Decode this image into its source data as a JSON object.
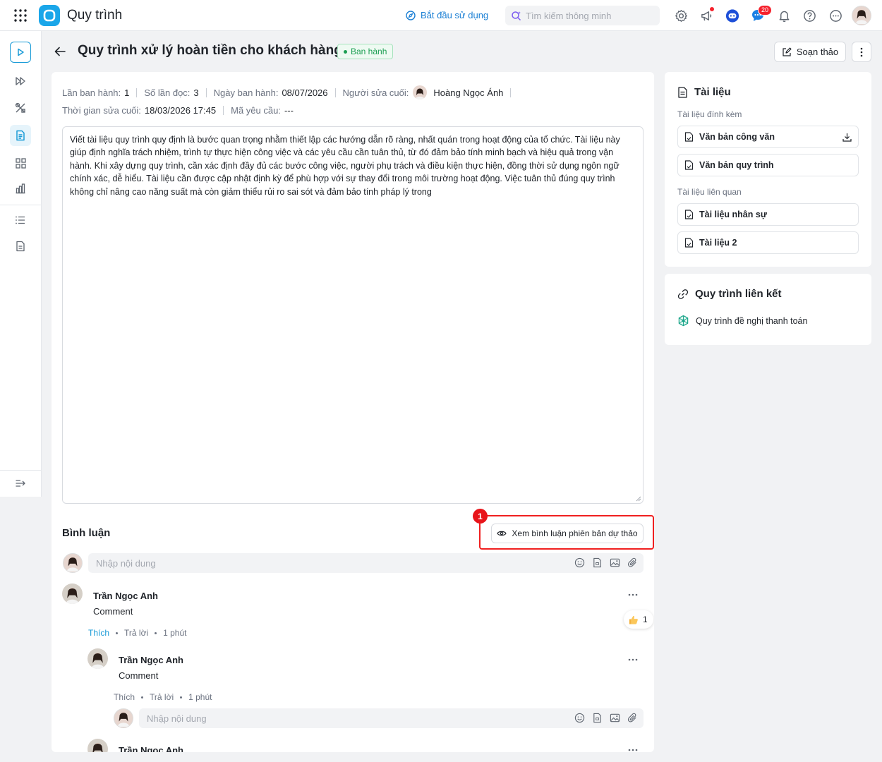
{
  "app": {
    "title": "Quy trình"
  },
  "topbar": {
    "start_label": "Bắt đầu sử dụng",
    "search_placeholder": "Tìm kiếm thông minh",
    "chat_badge": "20"
  },
  "page": {
    "title": "Quy trình xử lý hoàn tiền cho khách hàng",
    "status": "Ban hành",
    "draft_button": "Soạn thảo"
  },
  "meta": {
    "release_count_label": "Lần ban hành:",
    "release_count": "1",
    "read_count_label": "Số lần đọc:",
    "read_count": "3",
    "release_date_label": "Ngày ban hành:",
    "release_date": "08/07/2026",
    "last_editor_label": "Người sửa cuối:",
    "last_editor": "Hoàng Ngọc Ánh",
    "last_edit_time_label": "Thời gian sửa cuối:",
    "last_edit_time": "18/03/2026 17:45",
    "request_code_label": "Mã yêu cầu:",
    "request_code": "---"
  },
  "document": {
    "body": "Viết tài liệu quy trình quy định là bước quan trọng nhằm thiết lập các hướng dẫn rõ ràng, nhất quán trong hoạt động của tổ chức. Tài liệu này giúp định nghĩa trách nhiệm, trình tự thực hiện công việc và các yêu cầu cần tuân thủ, từ đó đảm bảo tính minh bạch và hiệu quả trong vận hành. Khi xây dựng quy trình, cần xác định đầy đủ các bước công việc, người phụ trách và điều kiện thực hiện, đồng thời sử dụng ngôn ngữ chính xác, dễ hiểu. Tài liệu cần được cập nhật định kỳ để phù hợp với sự thay đổi trong môi trường hoạt động. Việc tuân thủ đúng quy trình không chỉ nâng cao năng suất mà còn giảm thiểu rủi ro sai sót và đảm bảo tính pháp lý trong"
  },
  "comments": {
    "title": "Bình luận",
    "draft_button": "Xem bình luận phiên bản dự thảo",
    "annotation_number": "1",
    "input_placeholder": "Nhập nội dung",
    "items": [
      {
        "name": "Trần Ngọc Anh",
        "text": "Comment",
        "like": "Thích",
        "reply": "Trả lời",
        "time": "1 phút",
        "reaction_count": "1"
      },
      {
        "name": "Trần Ngọc Anh",
        "text": "Comment",
        "like": "Thích",
        "reply": "Trả lời",
        "time": "1 phút"
      },
      {
        "name": "Trần Ngọc Anh"
      }
    ]
  },
  "documents_panel": {
    "title": "Tài liệu",
    "attached_label": "Tài liệu đính kèm",
    "attached": [
      "Văn bản công văn",
      "Văn bản quy trình"
    ],
    "related_label": "Tài liệu liên quan",
    "related": [
      "Tài liệu nhân sự",
      "Tài liệu 2"
    ]
  },
  "linked_panel": {
    "title": "Quy trình liên kết",
    "items": [
      "Quy trình đề nghị thanh toán"
    ]
  },
  "colors": {
    "accent": "#1a9bd7",
    "status_green": "#1b9e52",
    "annotation_red": "#e8141a"
  }
}
